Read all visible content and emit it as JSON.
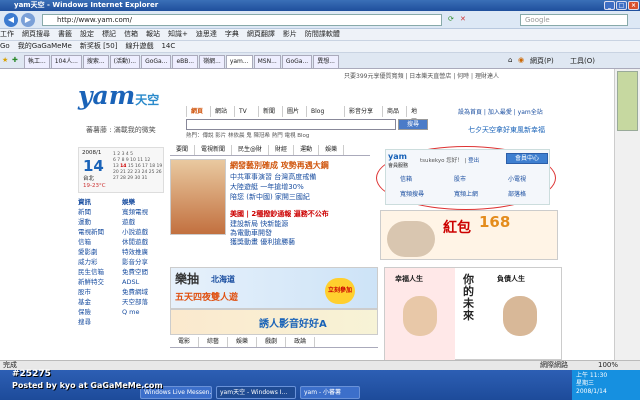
{
  "window": {
    "title": "yam天空 - Windows Internet Explorer"
  },
  "browser": {
    "url": "http://www.yam.com/",
    "search_placeholder": "Google",
    "tabs": [
      "執工...",
      "104人...",
      "搜索...",
      "(活動)...",
      "GoGa...",
      "eBB...",
      "嶺網...",
      "yam...",
      "MSN...",
      "GoGa...",
      "異想..."
    ]
  },
  "toolbar1": [
    "工作",
    "網頁搜尋",
    "書籤",
    "設定",
    "標記",
    "信箱",
    "報站",
    "知識+",
    "迪思達",
    "字典",
    "網頁翻譯",
    "影片",
    "防間諜軟體"
  ],
  "toolbar2": [
    "Go",
    "我的GaGaMeMe",
    "新奖板 [50]",
    "線升遊戲",
    "14C"
  ],
  "toolbar3": [
    "網頁(P)",
    "工具(O)"
  ],
  "header": {
    "tagline": "只要399元享優質寬頻 | 日本樂天直營店 | 何時 | 理財達人",
    "links": "設為首頁 | 加入最愛 | yam全站",
    "logo_main": "yam",
    "logo_sub": "天空",
    "slogan": "蕃薯藤 : 滿載我的微笑",
    "right_promo": "七夕天空拿好東風新幸福"
  },
  "nav": [
    "網頁",
    "網站",
    "TV",
    "新聞",
    "圖片",
    "Blog",
    "影音分享",
    "商品",
    "地圖"
  ],
  "search": {
    "button": "搜尋",
    "hot": "熱門：傳說 影片 林依晨 鬼 陳冠希 熱門 電視 Blog"
  },
  "calendar": {
    "year_month": "2008/1",
    "day": "14",
    "weekday": "星期一",
    "location": "台北",
    "temp": "19-23°C"
  },
  "sidebar": {
    "left": [
      [
        "資訊",
        "新聞",
        "運動",
        "電視新聞",
        "信箱",
        "愛影劇",
        "威力彩",
        "民生信箱",
        "新鮮特交",
        "股市",
        "基金",
        "保險",
        "搜尋"
      ],
      [
        "娛樂",
        "寬頻電視",
        "遊戲",
        "小說遊戲",
        "休閒遊戲",
        "特效推廣",
        "影音分享",
        "免費空間",
        "ADSL",
        "免費網域",
        "天空部落",
        "Q me"
      ]
    ]
  },
  "news": {
    "tabs": [
      "要聞",
      "電視新聞",
      "民生@財",
      "財經",
      "運動",
      "娛樂"
    ],
    "headline": "網發藝別確成 攻勢再遇大鋼",
    "items": [
      "中共軍事演習 台灣高度戒備",
      "大陸遊艇 一年搶增30%",
      "陪您 (新中國) 家開三國紀"
    ],
    "headline2": "美國 | 2種撥鈔通報 逼務不公布",
    "items2": [
      "建設新局 快新能源",
      "為電動車開發",
      "獲獎動畫 優利搶勝藝"
    ]
  },
  "member": {
    "service": "會員服務",
    "user": "tsukekyo",
    "greeting": "您好！",
    "logout": "登出",
    "center_btn": "會員中心",
    "items": [
      "信箱",
      "股市",
      "小電視",
      "寬頻搜尋",
      "寬頻上網",
      "部落格"
    ]
  },
  "promos": {
    "redenv": "紅包",
    "redenv_num": "168",
    "hokkaido": "北海道",
    "lottery": "樂抽",
    "trip": "五天四夜雙人遊",
    "trip2": "立刻參加",
    "video": "誘人影音好好A"
  },
  "bottom_tabs": [
    "電影",
    "綜藝",
    "娛樂",
    "戲劇",
    "政論"
  ],
  "ad_right": {
    "left": "幸福人生",
    "center": "你的未來",
    "right": "負債人生"
  },
  "statusbar": {
    "left": "完成",
    "zone": "網際網路",
    "zoom": "100%"
  },
  "taskbar": {
    "tasks": [
      "Windows Live Messen...",
      "yam天空 - Windows I...",
      "yam - 小蕃薯"
    ],
    "time": "上午 11:30",
    "day": "星期三",
    "date": "2008/1/14"
  },
  "watermark": {
    "line1": "#25275",
    "line2": "Posted by kyo at GaGaMeMe.com"
  }
}
